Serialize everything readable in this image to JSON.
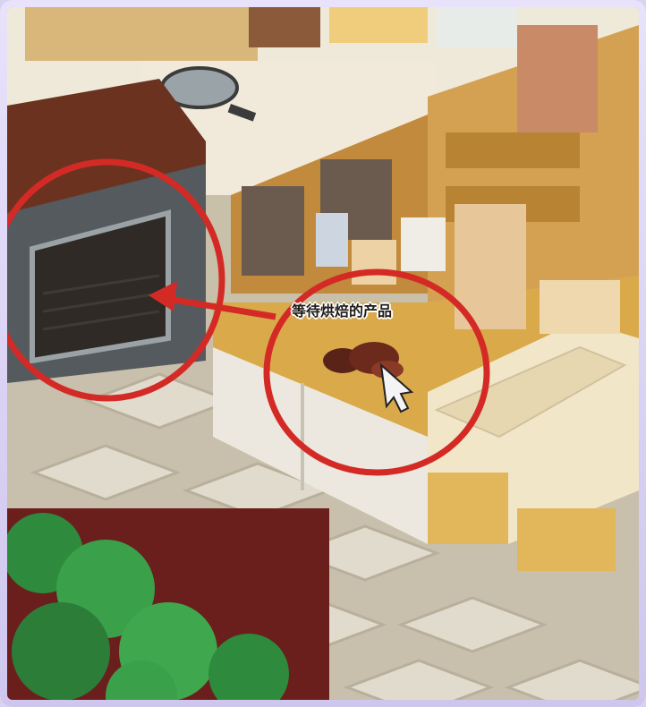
{
  "scene": {
    "prompt_label": "等待烘焙的产品"
  },
  "colors": {
    "annotation_red": "#d42a26",
    "counter_top": "#d9a94a",
    "floor_light": "#d8d2c4",
    "floor_dark": "#b4ab99"
  },
  "icons": {
    "cursor": "pointer-cursor-icon",
    "product": "bread-dough-icon"
  }
}
